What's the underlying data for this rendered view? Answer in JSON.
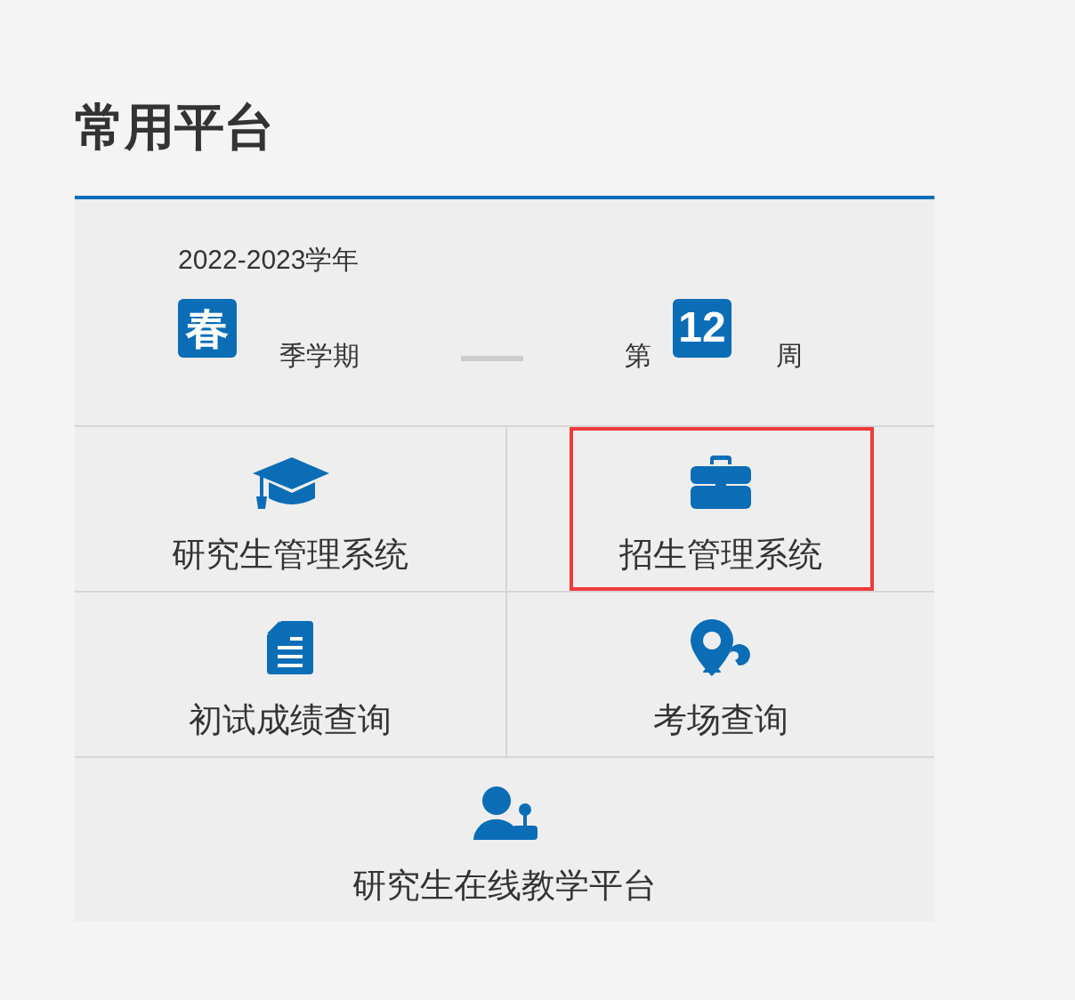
{
  "title": "常用平台",
  "term": {
    "year": "2022-2023学年",
    "season": "春",
    "season_suffix": "季学期",
    "week_prefix": "第",
    "week": "12",
    "week_suffix": "周"
  },
  "tiles": [
    {
      "kind": "cap",
      "label": "研究生管理系统",
      "highlighted": false
    },
    {
      "kind": "briefcase",
      "label": "招生管理系统",
      "highlighted": true
    },
    {
      "kind": "document",
      "label": "初试成绩查询",
      "highlighted": false
    },
    {
      "kind": "pin",
      "label": "考场查询",
      "highlighted": false
    },
    {
      "kind": "speaker",
      "label": "研究生在线教学平台",
      "highlighted": false
    }
  ]
}
